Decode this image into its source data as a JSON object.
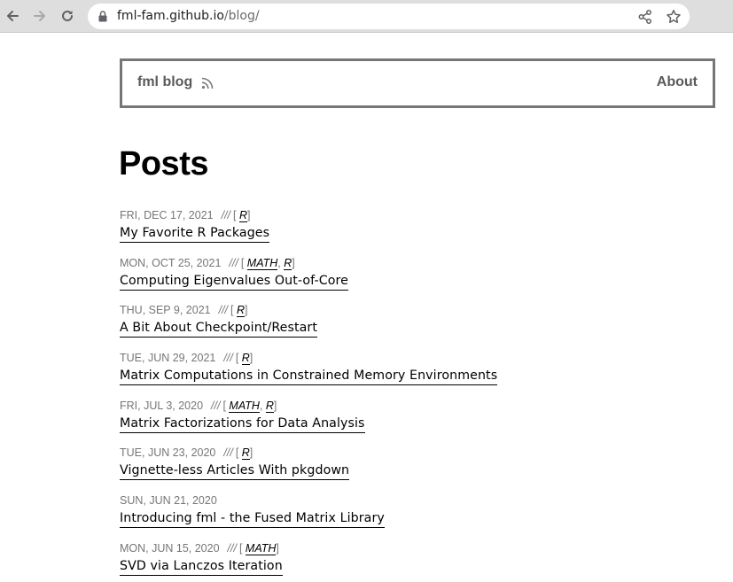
{
  "browser": {
    "url_host": "fml-fam.github.io",
    "url_path": "/blog/",
    "icons": [
      "back-arrow-icon",
      "forward-arrow-icon",
      "reload-icon",
      "lock-icon",
      "share-icon",
      "star-icon"
    ]
  },
  "header": {
    "brand": "fml blog",
    "about": "About"
  },
  "main": {
    "title": "Posts",
    "posts": [
      {
        "date": "FRI, DEC 17, 2021",
        "sep": "///",
        "tags": [
          "R"
        ],
        "title": "My Favorite R Packages"
      },
      {
        "date": "MON, OCT 25, 2021",
        "sep": "///",
        "tags": [
          "MATH",
          "R"
        ],
        "title": "Computing Eigenvalues Out-of-Core"
      },
      {
        "date": "THU, SEP 9, 2021",
        "sep": "///",
        "tags": [
          "R"
        ],
        "title": "A Bit About Checkpoint/Restart"
      },
      {
        "date": "TUE, JUN 29, 2021",
        "sep": "///",
        "tags": [
          "R"
        ],
        "title": "Matrix Computations in Constrained Memory Environments"
      },
      {
        "date": "FRI, JUL 3, 2020",
        "sep": "///",
        "tags": [
          "MATH",
          "R"
        ],
        "title": "Matrix Factorizations for Data Analysis"
      },
      {
        "date": "TUE, JUN 23, 2020",
        "sep": "///",
        "tags": [
          "R"
        ],
        "title": "Vignette-less Articles With pkgdown"
      },
      {
        "date": "SUN, JUN 21, 2020",
        "sep": "",
        "tags": [],
        "title": "Introducing fml - the Fused Matrix Library"
      },
      {
        "date": "MON, JUN 15, 2020",
        "sep": "///",
        "tags": [
          "MATH"
        ],
        "title": "SVD via Lanczos Iteration"
      }
    ]
  }
}
